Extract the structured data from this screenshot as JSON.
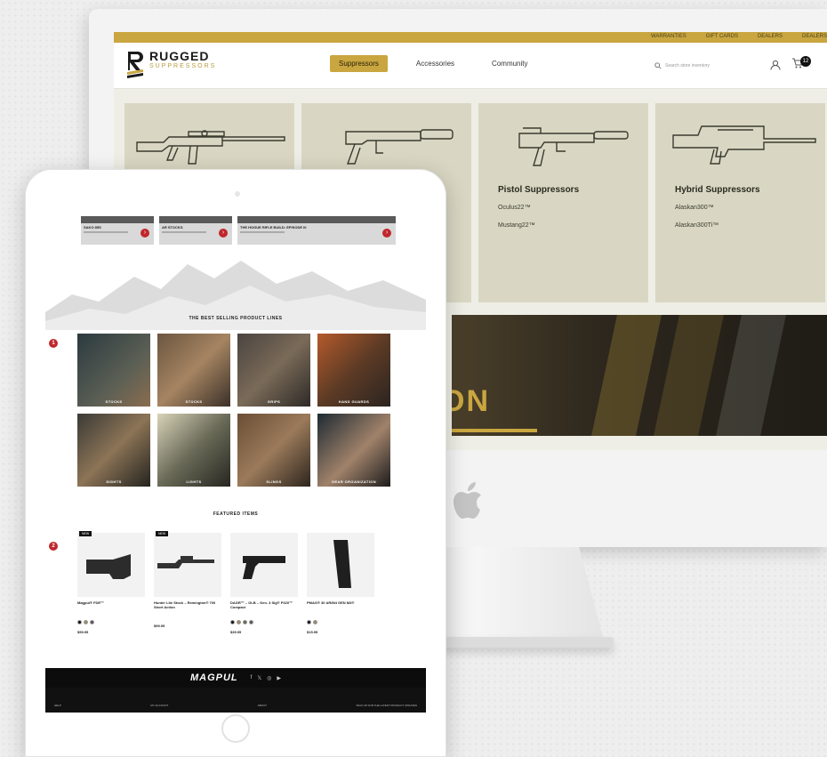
{
  "imac": {
    "top_links": [
      "WARRANTIES",
      "GIFT CARDS",
      "DEALERS",
      "DEALERS"
    ],
    "logo": {
      "title": "RUGGED",
      "subtitle": "SUPPRESSORS"
    },
    "nav": [
      {
        "label": "Suppressors",
        "active": true
      },
      {
        "label": "Accessories",
        "active": false
      },
      {
        "label": "Community",
        "active": false
      }
    ],
    "search_placeholder": "Search store inventory",
    "cart_count": "12",
    "categories": [
      {
        "title": "",
        "links": []
      },
      {
        "title": "",
        "links": []
      },
      {
        "title": "Pistol Suppressors",
        "links": [
          "Oculus22™",
          "Mustang22™"
        ]
      },
      {
        "title": "Hybrid Suppressors",
        "links": [
          "Alaskan300™",
          "Alaskan300Ti™"
        ]
      }
    ],
    "banner_text": "ON",
    "accent_color": "#c9a640"
  },
  "ipad": {
    "blogs": [
      {
        "title": "SAKO 85S",
        "sub": ""
      },
      {
        "title": "AR STOCKS",
        "sub": ""
      },
      {
        "title": "THE HOGUE RIFLE BUILD: EPISODE III",
        "sub": ""
      }
    ],
    "best_selling_title": "THE BEST SELLING PRODUCT LINES",
    "marker_1": "1",
    "product_lines": [
      "STOCKS",
      "STOCKS",
      "GRIPS",
      "HAND GUARDS",
      "SIGHTS",
      "LIGHTS",
      "SLINGS",
      "GEAR ORGANIZATION"
    ],
    "featured_title": "FEATURED ITEMS",
    "marker_2": "2",
    "badge_new": "NEW",
    "featured": [
      {
        "name": "Magpul® FDE™",
        "desc": "",
        "price": "$59.95",
        "badge": "NEW"
      },
      {
        "name": "Hunter Lite Stock – Remington® 700 Short Action",
        "desc": "",
        "price": "$99.95",
        "badge": "NEW"
      },
      {
        "name": "DAGR™ – GLB – Gen. 3 Sig® P320™ Compact",
        "desc": "",
        "price": "$39.95",
        "badge": ""
      },
      {
        "name": "PMAG® 30 AR/M4 GEN M3®",
        "desc": "",
        "price": "$15.95",
        "badge": ""
      }
    ],
    "footer": {
      "brand": "MAGPUL",
      "social": [
        "f",
        "𝕏",
        "◎",
        "▶"
      ],
      "links": [
        "HELP",
        "MY ACCOUNT",
        "ABOUT",
        "SIGN UP FOR THE LATEST PRODUCT UPDATES"
      ]
    },
    "brand_red": "#c0272d"
  }
}
